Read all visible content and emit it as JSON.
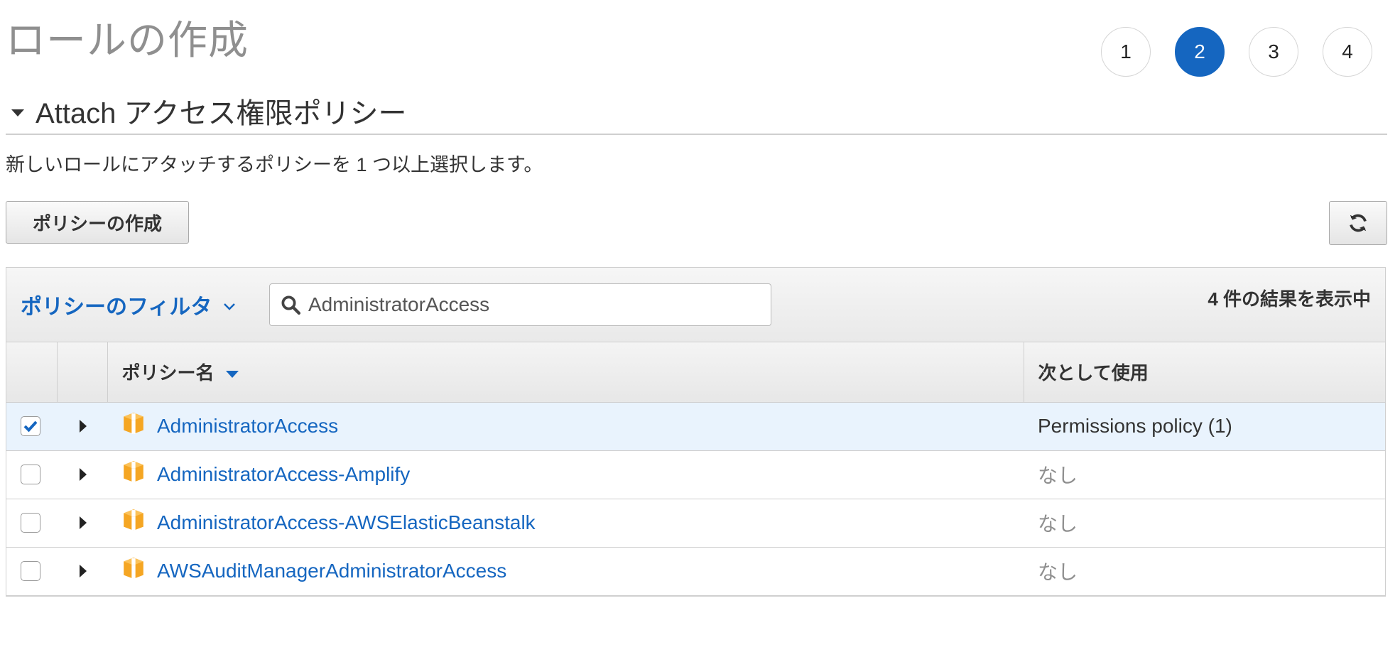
{
  "header": {
    "title": "ロールの作成",
    "steps": [
      "1",
      "2",
      "3",
      "4"
    ],
    "active_step": "2"
  },
  "section": {
    "title": "Attach アクセス権限ポリシー",
    "description": "新しいロールにアタッチするポリシーを 1 つ以上選択します。"
  },
  "toolbar": {
    "create_policy_label": "ポリシーの作成",
    "refresh_icon": "refresh-icon"
  },
  "filter": {
    "label": "ポリシーのフィルタ",
    "search_value": "AdministratorAccess",
    "result_count": "4 件の結果を表示中"
  },
  "table": {
    "columns": {
      "policy_name": "ポリシー名",
      "used_as": "次として使用"
    },
    "rows": [
      {
        "name": "AdministratorAccess",
        "used_as": "Permissions policy (1)",
        "checked": true
      },
      {
        "name": "AdministratorAccess-Amplify",
        "used_as": "なし",
        "checked": false
      },
      {
        "name": "AdministratorAccess-AWSElasticBeanstalk",
        "used_as": "なし",
        "checked": false
      },
      {
        "name": "AWSAuditManagerAdministratorAccess",
        "used_as": "なし",
        "checked": false
      }
    ]
  },
  "colors": {
    "accent": "#1566c0",
    "selected_row": "#e9f3fd",
    "policy_icon": "#f5a623"
  }
}
